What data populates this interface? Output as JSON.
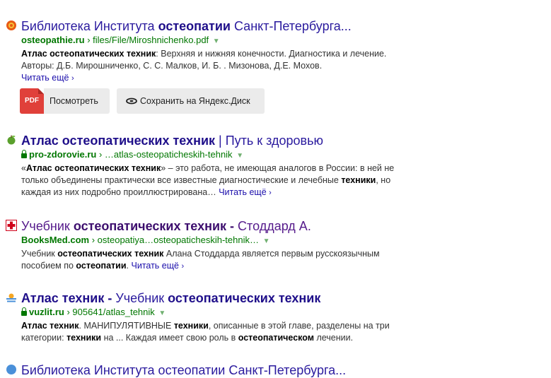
{
  "results": [
    {
      "icon": "osteopathie-favicon",
      "title": [
        "Библиотека Института ",
        "остеопатии",
        " Санкт-Петербурга..."
      ],
      "domain": "osteopathie.ru",
      "path": "› files/File/Miroshnichenko.pdf",
      "snippet": {
        "lead_bold": "Атлас остеопатических техник",
        "text": ": Верхняя и нижняя конечности. Диагностика и лечение. Авторы: Д.Б. Мирошниченко, С. С. Малков, И. Б. . Мизонова, Д.Е. Мохов."
      },
      "more": "Читать ещё",
      "buttons": {
        "pdf_badge": "PDF",
        "view": "Посмотреть",
        "save": "Сохранить на Яндекс.Диск"
      }
    },
    {
      "icon": "apple-icon",
      "title": [
        "Атлас остеопатических техник",
        " | Путь к здоровью"
      ],
      "domain": "pro-zdorovie.ru",
      "path": "› …atlas-osteopaticheskih-tehnik",
      "snippet": {
        "p1": "«",
        "b1": "Атлас остеопатических техник",
        "p2": "» – это работа, не имеющая аналогов в России: в ней не только объединены практически все известные диагностические и лечебные ",
        "b2": "техники",
        "p3": ", но каждая из них подробно проиллюстрирована… "
      },
      "more": "Читать ещё"
    },
    {
      "icon": "red-cross-icon",
      "title": [
        "Учебник ",
        "остеопатических техник -",
        " Стоддард А."
      ],
      "domain": "BooksMed.com",
      "path": "› osteopatiya…osteopaticheskih-tehnik…",
      "snippet": {
        "p1": "Учебник ",
        "b1": "остеопатических техник",
        "p2": " Алана Стоддарда является первым русскоязычным пособием по ",
        "b2": "остеопатии",
        "p3": ". "
      },
      "more": "Читать ещё"
    },
    {
      "icon": "vuzlit-icon",
      "title": [
        "Атлас техник -",
        " Учебник ",
        "остеопатических техник"
      ],
      "domain": "vuzlit.ru",
      "path": "› 905641/atlas_tehnik",
      "snippet": {
        "b1": "Атлас техник",
        "p1": ". МАНИПУЛЯТИВНЫЕ ",
        "b2": "техники",
        "p2": ", описанные в этой главе, разделены на три категории: ",
        "b3": "техники",
        "p3": " на ... Каждая имеет свою роль в ",
        "b4": "остеопатическом",
        "p4": " лечении."
      }
    },
    {
      "title_partial": "Библиотека Института остеопатии Санкт-Петербурга..."
    }
  ],
  "colors": {
    "link": "#1a0dab",
    "visited": "#551a8b",
    "url": "#007700",
    "snippet": "#333333",
    "button_bg": "#ebebeb",
    "pdf_red": "#e0403a"
  }
}
